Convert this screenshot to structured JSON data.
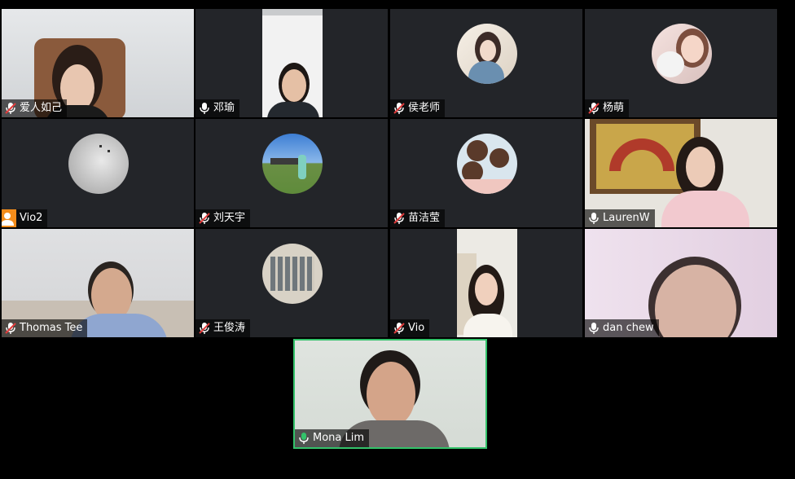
{
  "participants": [
    {
      "name": "爱人如己",
      "mic": "muted"
    },
    {
      "name": "邓瑜",
      "mic": "on"
    },
    {
      "name": "侯老师",
      "mic": "muted"
    },
    {
      "name": "杨萌",
      "mic": "muted"
    },
    {
      "name": "Vio2",
      "mic": "person"
    },
    {
      "name": "刘天宇",
      "mic": "muted"
    },
    {
      "name": "苗洁莹",
      "mic": "muted"
    },
    {
      "name": "LaurenW",
      "mic": "on"
    },
    {
      "name": "Thomas Tee",
      "mic": "muted"
    },
    {
      "name": "王俊涛",
      "mic": "muted"
    },
    {
      "name": "Vio",
      "mic": "muted"
    },
    {
      "name": "dan chew",
      "mic": "on"
    },
    {
      "name": "Mona Lim",
      "mic": "active"
    }
  ],
  "colors": {
    "active_speaker": "#33c26a",
    "tile_bg": "#232529",
    "muted_icon": "#e03c3c",
    "vio2_avatar": "#f38c1a"
  }
}
